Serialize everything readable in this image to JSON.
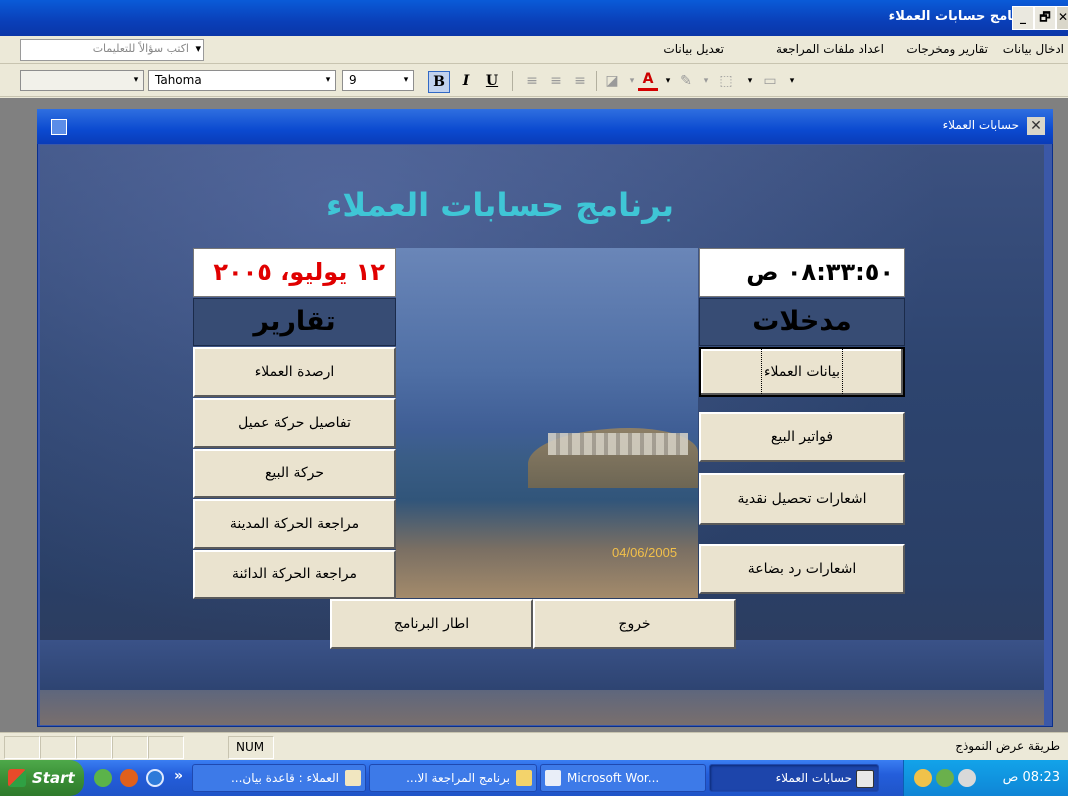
{
  "window": {
    "title": "برنامج حسابات العملاء",
    "buttons": {
      "minimize": "_",
      "restore": "🗗",
      "close": "✕"
    }
  },
  "menubar": {
    "items": [
      "ادخال بيانات",
      "تقارير ومخرجات",
      "اعداد ملفات المراجعة",
      "تعديل بيانات"
    ],
    "ask_placeholder": "اكتب سؤالاً للتعليمات"
  },
  "toolbar": {
    "font_name": "Tahoma",
    "font_size": "9",
    "bold": "B",
    "italic": "I",
    "underline": "U",
    "font_color_label": "A"
  },
  "form": {
    "title": "حسابات العملاء",
    "app_title": "برنامج حسابات العملاء",
    "date": "١٢ يوليو، ٢٠٠٥",
    "time": "٠٨:٣٣:٥٠ ص",
    "reports_header": "تقارير",
    "inputs_header": "مدخلات",
    "photo_stamp": "04/06/2005",
    "reports_buttons": [
      "ارصدة العملاء",
      "تفاصيل حركة عميل",
      "حركة البيع",
      "مراجعة الحركة المدينة",
      "مراجعة الحركة الدائنة"
    ],
    "inputs_buttons": [
      "بيانات العملاء",
      "فواتير البيع",
      "اشعارات تحصيل نقدية",
      "اشعارات رد بضاعة"
    ],
    "exit_button": "خروج",
    "frame_button": "اطار البرنامج"
  },
  "statusbar": {
    "text": "طريقة عرض النموذج",
    "num": "NUM"
  },
  "taskbar": {
    "start": "Start",
    "chevron": "»",
    "tasks": [
      "العملاء : قاعدة بيان...",
      "برنامج المراجعة الا...",
      "Microsoft Wor...",
      "حسابات العملاء"
    ],
    "clock": "08:23 ص"
  }
}
